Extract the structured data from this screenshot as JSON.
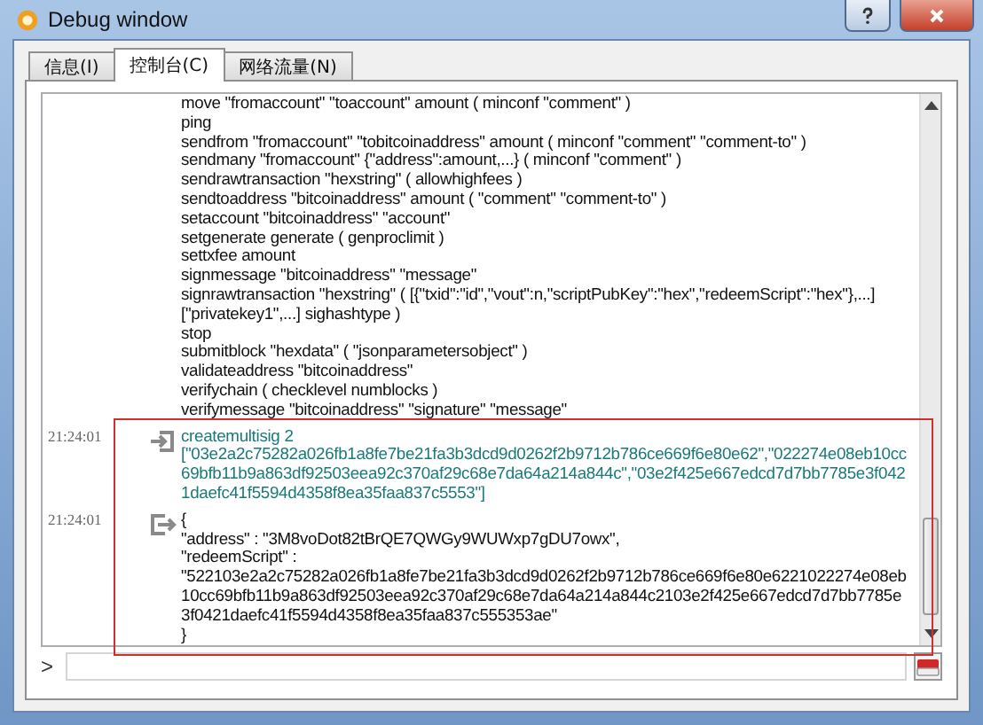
{
  "window": {
    "title": "Debug window"
  },
  "tabs": [
    {
      "label": "信息(I)",
      "selected": false
    },
    {
      "label": "控制台(C)",
      "selected": true
    },
    {
      "label": "网络流量(N)",
      "selected": false
    }
  ],
  "help_lines": [
    "move \"fromaccount\" \"toaccount\" amount ( minconf \"comment\" )",
    "ping",
    "sendfrom \"fromaccount\" \"tobitcoinaddress\" amount ( minconf \"comment\" \"comment-to\" )",
    "sendmany \"fromaccount\" {\"address\":amount,...} ( minconf \"comment\" )",
    "sendrawtransaction \"hexstring\" ( allowhighfees )",
    "sendtoaddress \"bitcoinaddress\" amount ( \"comment\" \"comment-to\" )",
    "setaccount \"bitcoinaddress\" \"account\"",
    "setgenerate generate ( genproclimit )",
    "settxfee amount",
    "signmessage \"bitcoinaddress\" \"message\"",
    "signrawtransaction \"hexstring\" ( [{\"txid\":\"id\",\"vout\":n,\"scriptPubKey\":\"hex\",\"redeemScript\":\"hex\"},...]",
    "[\"privatekey1\",...] sighashtype )",
    "stop",
    "submitblock \"hexdata\" ( \"jsonparametersobject\" )",
    "validateaddress \"bitcoinaddress\"",
    "verifychain ( checklevel numblocks )",
    "verifymessage \"bitcoinaddress\" \"signature\" \"message\""
  ],
  "entries": [
    {
      "time": "21:24:01",
      "kind": "command",
      "lines": [
        "createmultisig 2",
        "[\"03e2a2c75282a026fb1a8fe7be21fa3b3dcd9d0262f2b9712b786ce669f6e80e62\",\"022274e08eb10cc",
        "69bfb11b9a863df92503eea92c370af29c68e7da64a214a844c\",\"03e2f425e667edcd7d7bb7785e3f042",
        "1daefc41f5594d4358f8ea35faa837c5553\"]"
      ]
    },
    {
      "time": "21:24:01",
      "kind": "reply",
      "lines": [
        "{",
        "\"address\" : \"3M8voDot82tBrQE7QWGy9WUWxp7gDU7owx\",",
        "\"redeemScript\" :",
        "\"522103e2a2c75282a026fb1a8fe7be21fa3b3dcd9d0262f2b9712b786ce669f6e80e6221022274e08eb",
        "10cc69bfb11b9a863df92503eea92c370af29c68e7da64a214a844c2103e2f425e667edcd7d7bb7785e",
        "3f0421daefc41f5594d4358f8ea35faa837c555353ae\"",
        "}"
      ]
    }
  ],
  "prompt": ">"
}
